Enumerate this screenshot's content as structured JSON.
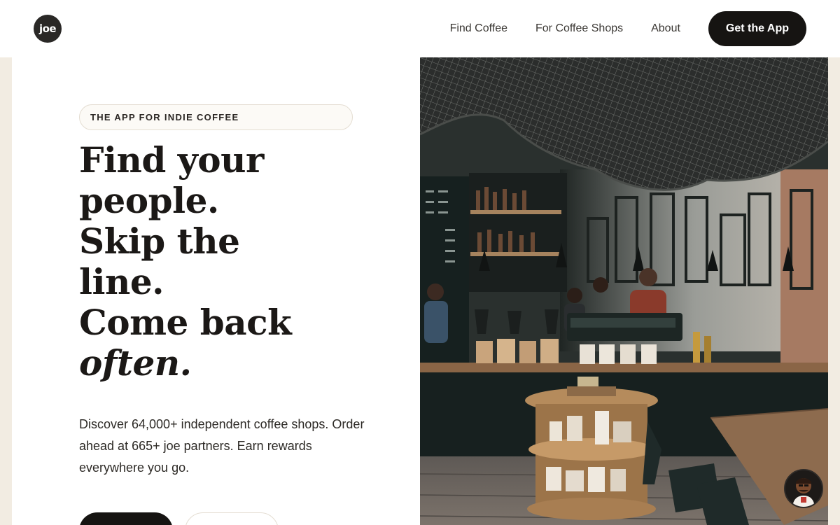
{
  "header": {
    "logo_text": "joe",
    "nav": [
      "Find Coffee",
      "For Coffee Shops",
      "About"
    ],
    "cta_label": "Get the App"
  },
  "hero": {
    "eyebrow": "THE APP FOR INDIE COFFEE",
    "headline_lines": [
      "Find your",
      "people.",
      "Skip the",
      "line.",
      "Come back"
    ],
    "headline_emphasis": "often.",
    "lede": "Discover 64,000+ independent coffee shops. Order ahead at 665+ joe partners. Earn rewards everywhere you go."
  },
  "colors": {
    "page_bg": "#f2ece2",
    "ink": "#161412",
    "card": "#ffffff"
  },
  "icons": {
    "logo": "joe-logo-icon",
    "chat": "barista-avatar-icon"
  }
}
